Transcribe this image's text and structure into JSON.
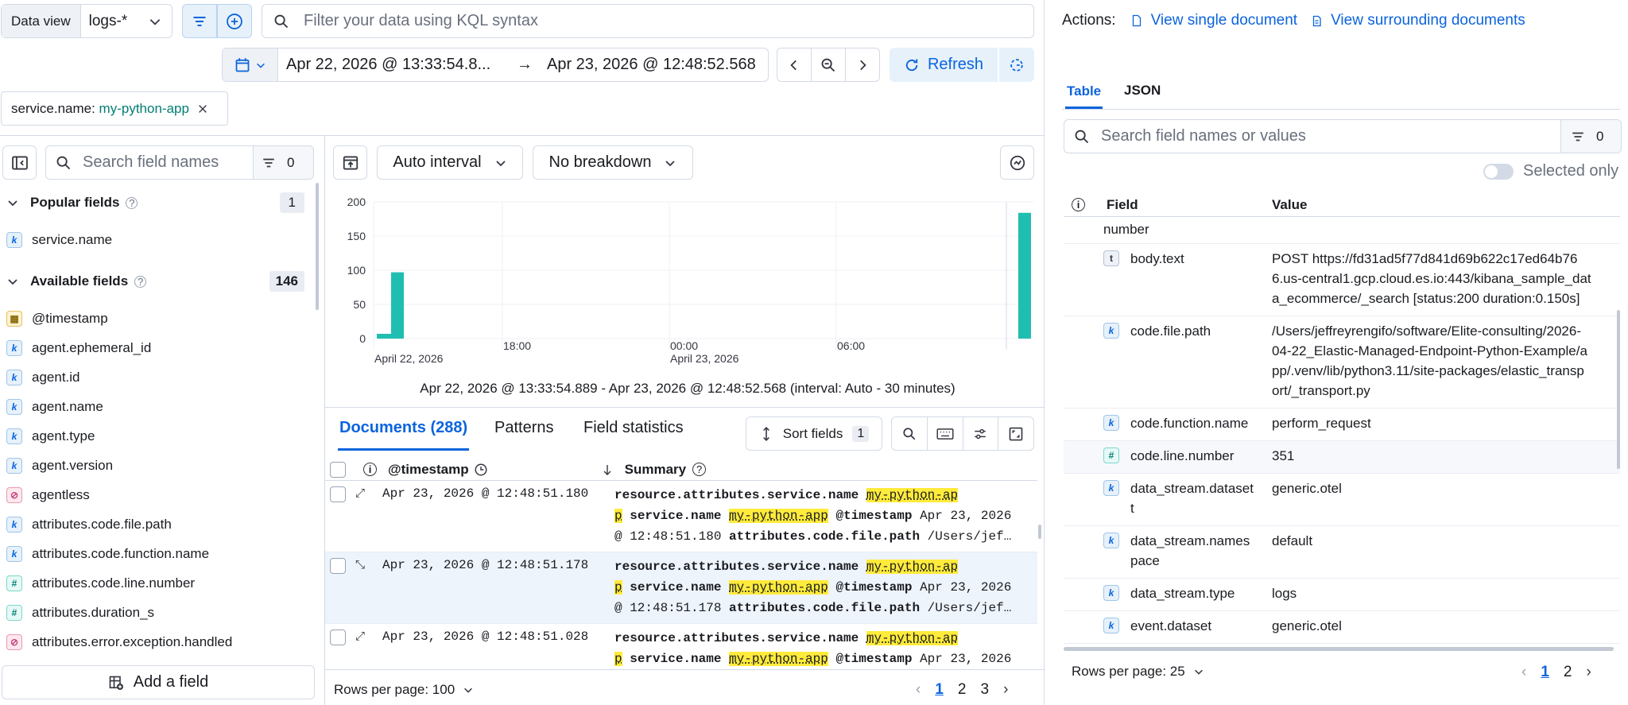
{
  "toolbar": {
    "data_view_label": "Data view",
    "data_view_value": "logs-*",
    "query_placeholder": "Filter your data using KQL syntax",
    "date_start": "Apr 22, 2026 @ 13:33:54.8...",
    "date_arrow": "→",
    "date_end": "Apr 23, 2026 @ 12:48:52.568",
    "refresh_label": "Refresh"
  },
  "filter_pill": {
    "key": "service.name: ",
    "value": "my-python-app"
  },
  "sidebar": {
    "search_placeholder": "Search field names",
    "filter_count": "0",
    "popular_title": "Popular fields",
    "popular_count": "1",
    "popular_fields": [
      {
        "type": "k",
        "name": "service.name"
      }
    ],
    "available_title": "Available fields",
    "available_count": "146",
    "available_fields": [
      {
        "type": "d",
        "name": "@timestamp"
      },
      {
        "type": "k",
        "name": "agent.ephemeral_id"
      },
      {
        "type": "k",
        "name": "agent.id"
      },
      {
        "type": "k",
        "name": "agent.name"
      },
      {
        "type": "k",
        "name": "agent.type"
      },
      {
        "type": "k",
        "name": "agent.version"
      },
      {
        "type": "b",
        "name": "agentless"
      },
      {
        "type": "k",
        "name": "attributes.code.file.path"
      },
      {
        "type": "k",
        "name": "attributes.code.function.name"
      },
      {
        "type": "n",
        "name": "attributes.code.line.number"
      },
      {
        "type": "n",
        "name": "attributes.duration_s"
      },
      {
        "type": "b",
        "name": "attributes.error.exception.handled"
      }
    ],
    "add_field_label": "Add a field"
  },
  "chart_controls": {
    "interval_label": "Auto interval",
    "breakdown_label": "No breakdown"
  },
  "chart_data": {
    "type": "bar",
    "yticks": [
      "200",
      "150",
      "100",
      "50",
      "0"
    ],
    "xticks": [
      {
        "label": "April 22, 2026",
        "sub": ""
      },
      {
        "label": "18:00",
        "sub": ""
      },
      {
        "label": "00:00",
        "sub": "April 23, 2026"
      },
      {
        "label": "06:00",
        "sub": ""
      }
    ],
    "bars": [
      {
        "time": "Apr 22, 2026 @ 13:30",
        "value": 7
      },
      {
        "time": "Apr 22, 2026 @ 14:00",
        "value": 97
      },
      {
        "time": "Apr 23, 2026 @ 12:30",
        "value": 184
      }
    ],
    "ylim": [
      0,
      200
    ],
    "color": "#20beb0",
    "caption": "Apr 22, 2026 @ 13:33:54.889 - Apr 23, 2026 @ 12:48:52.568 (interval: Auto - 30 minutes)"
  },
  "doc_tabs": {
    "documents": "Documents (288)",
    "patterns": "Patterns",
    "field_stats": "Field statistics",
    "sort_label": "Sort fields",
    "sort_count": "1"
  },
  "grid": {
    "col_timestamp": "@timestamp",
    "col_summary": "Summary",
    "rows": [
      {
        "ts": "Apr 23, 2026 @ 12:48:51.180",
        "l1a": "resource.attributes.service.name ",
        "l1hl": "my-python-ap",
        "l2hl1": "p",
        "l2b": " service.name ",
        "l2hl2": "my-python-app",
        "l2c": " @timestamp ",
        "l2d": "Apr 23, 2026",
        "l3a": "@ 12:48:51.180 ",
        "l3b": "attributes.code.file.path ",
        "l3c": "/Users/jef…"
      },
      {
        "ts": "Apr 23, 2026 @ 12:48:51.178",
        "l1a": "resource.attributes.service.name ",
        "l1hl": "my-python-ap",
        "l2hl1": "p",
        "l2b": " service.name ",
        "l2hl2": "my-python-app",
        "l2c": " @timestamp ",
        "l2d": "Apr 23, 2026",
        "l3a": "@ 12:48:51.178 ",
        "l3b": "attributes.code.file.path ",
        "l3c": "/Users/jef…"
      },
      {
        "ts": "Apr 23, 2026 @ 12:48:51.028",
        "l1a": "resource.attributes.service.name ",
        "l1hl": "my-python-ap",
        "l2hl1": "p",
        "l2b": " service.name ",
        "l2hl2": "my-python-app",
        "l2c": " @timestamp ",
        "l2d": "Apr 23, 2026",
        "l3a": "",
        "l3b": "",
        "l3c": ""
      }
    ],
    "rows_per_page": "Rows per page: 100",
    "pages": [
      "1",
      "2",
      "3"
    ]
  },
  "flyout": {
    "actions_label": "Actions:",
    "view_single": "View single document",
    "view_surrounding": "View surrounding documents",
    "tab_table": "Table",
    "tab_json": "JSON",
    "search_placeholder": "Search field names or values",
    "filter_count": "0",
    "selected_only": "Selected only",
    "col_field": "Field",
    "col_value": "Value",
    "partial_field": "number",
    "rows": [
      {
        "type": "t",
        "field": [
          "body.text"
        ],
        "value": [
          "POST https://fd31ad5f77d841d69b622c17ed64b76",
          "6.us-central1.gcp.cloud.es.io:443/kibana_sample_dat",
          "a_ecommerce/_search [status:200 duration:0.150s]"
        ]
      },
      {
        "type": "k",
        "field": [
          "code.file.path"
        ],
        "value": [
          "/Users/jeffreyrengifo/software/Elite-consulting/2026-",
          "04-22_Elastic-Managed-Endpoint-Python-Example/a",
          "pp/.venv/lib/python3.11/site-packages/elastic_transp",
          "ort/_transport.py"
        ]
      },
      {
        "type": "k",
        "field": [
          "code.function.name"
        ],
        "value": [
          "perform_request"
        ]
      },
      {
        "type": "n",
        "field": [
          "code.line.number"
        ],
        "value": [
          "351"
        ]
      },
      {
        "type": "k",
        "field": [
          "data_stream.dataset",
          "t"
        ],
        "value": [
          "generic.otel"
        ]
      },
      {
        "type": "k",
        "field": [
          "data_stream.names",
          "pace"
        ],
        "value": [
          "default"
        ]
      },
      {
        "type": "k",
        "field": [
          "data_stream.type"
        ],
        "value": [
          "logs"
        ]
      },
      {
        "type": "k",
        "field": [
          "event.dataset"
        ],
        "value": [
          "generic.otel"
        ]
      }
    ],
    "rows_per_page": "Rows per page: 25",
    "pages": [
      "1",
      "2"
    ]
  }
}
